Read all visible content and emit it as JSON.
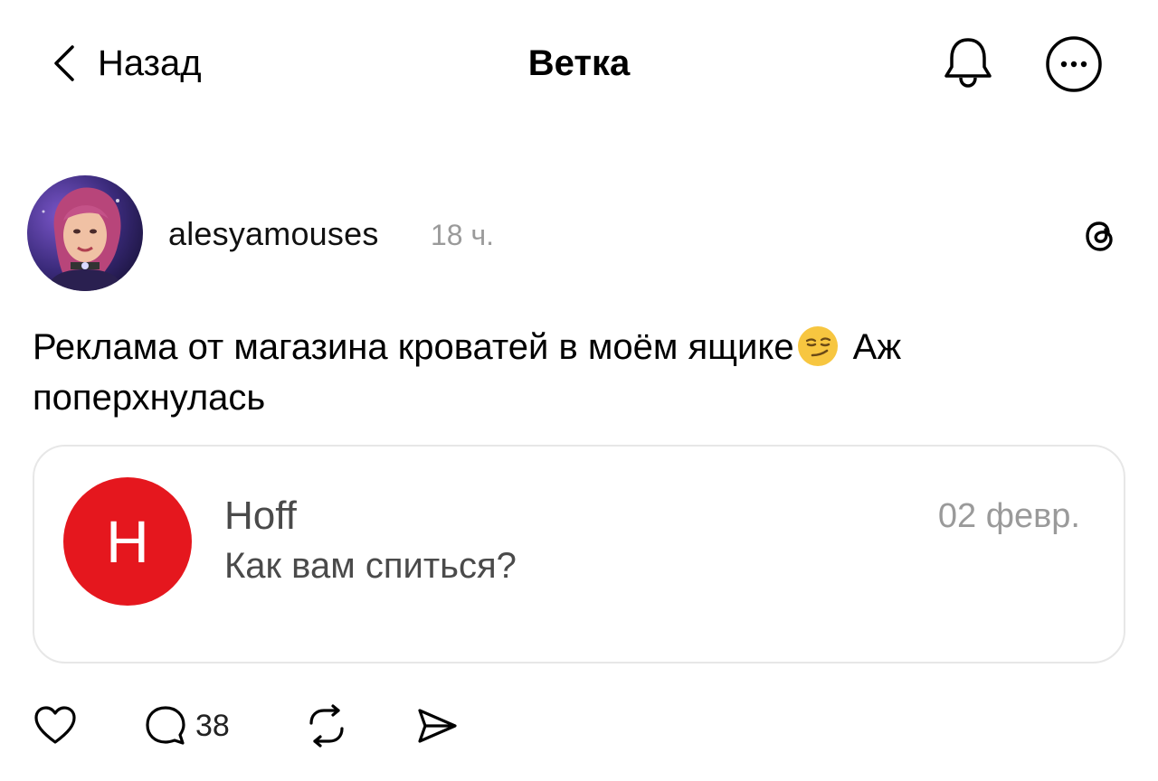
{
  "header": {
    "back_label": "Назад",
    "title": "Ветка",
    "icons": [
      "chevron-left-icon",
      "bell-icon",
      "more-icon"
    ]
  },
  "post": {
    "username": "alesyamouses",
    "time": "18 ч.",
    "text_part1": "Реклама от магазина кроватей в моём ящике",
    "emoji": "smirking-face-emoji",
    "text_part2": " Аж поперхнулась",
    "reply_count": "38"
  },
  "card": {
    "logo_letter": "H",
    "sender": "Hoff",
    "message": "Как вам спиться?",
    "date": "02 февр.",
    "logo_color": "#e5171e"
  },
  "colors": {
    "text": "#000000",
    "muted": "#9a9a9a",
    "card_border": "#e7e7e7"
  }
}
